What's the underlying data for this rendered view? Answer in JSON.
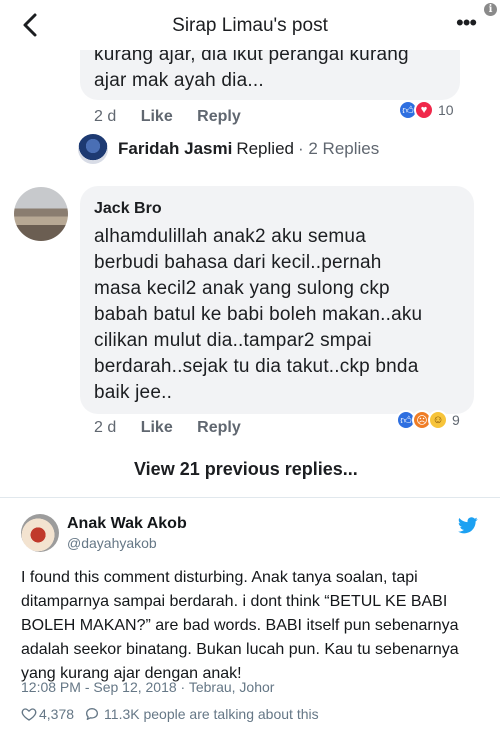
{
  "fb": {
    "title": "Sirap Limau's post",
    "more": "•••",
    "info": "i",
    "comment1": {
      "lines": [
        "kurang ajar, dia ikut perangai kurang",
        "ajar mak ayah dia..."
      ],
      "age": "2 d",
      "like": "Like",
      "reply": "Reply",
      "reaction_icons": [
        "like-icon",
        "love-icon"
      ],
      "reaction_count": "10"
    },
    "replied": {
      "name": "Faridah Jasmi",
      "text": "Replied",
      "count": "· 2 Replies"
    },
    "comment2": {
      "name": "Jack Bro",
      "lines": [
        "alhamdulillah anak2 aku semua",
        "berbudi bahasa dari kecil..pernah",
        "masa kecil2 anak yang sulong ckp",
        "babah batul ke babi boleh makan..aku",
        "cilikan mulut dia..tampar2 smpai",
        "berdarah..sejak tu dia takut..ckp bnda",
        "baik jee.."
      ],
      "age": "2 d",
      "like": "Like",
      "reply": "Reply",
      "reaction_icons": [
        "like-icon",
        "angry-icon",
        "haha-icon"
      ],
      "reaction_count": "9"
    },
    "view_more": "View 21 previous replies..."
  },
  "tweet": {
    "name": "Anak Wak Akob",
    "handle": "@dayahyakob",
    "body_lines": [
      "I found this comment disturbing. Anak tanya soalan, tapi",
      "ditamparnya sampai berdarah. i dont think “BETUL KE BABI",
      "BOLEH MAKAN?” are bad words. BABI itself pun sebenarnya",
      "adalah seekor binatang. Bukan lucah pun. Kau tu sebenarnya",
      "yang kurang ajar dengan anak!"
    ],
    "meta": "12:08 PM - Sep 12, 2018 · Tebrau, Johor",
    "likes": "4,378",
    "talking": "11.3K people are talking about this"
  },
  "colors": {
    "fb_bubble": "#f2f3f5",
    "like_blue": "#2e6fe0",
    "love_red": "#f0284a",
    "twitter_blue": "#1da1f2",
    "meta_gray": "#657786"
  }
}
